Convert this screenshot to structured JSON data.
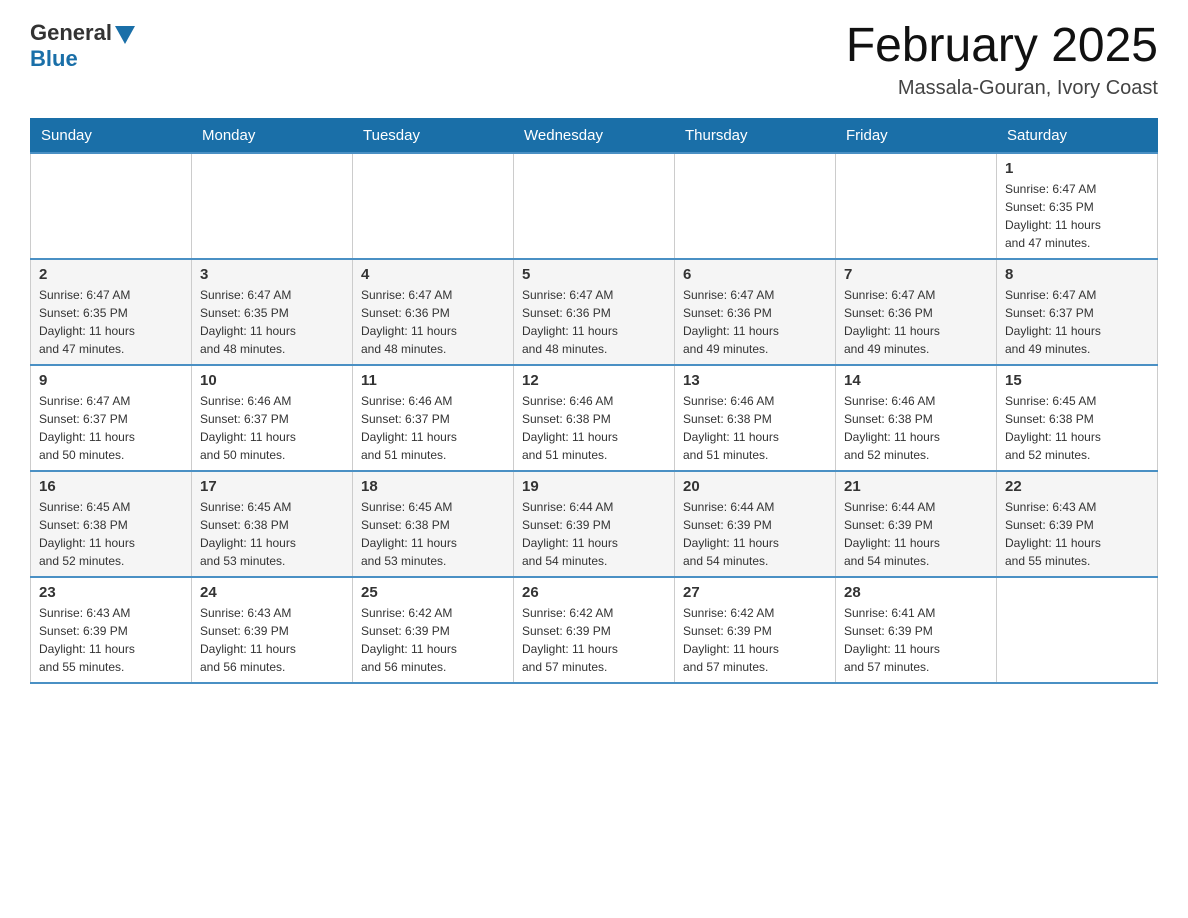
{
  "logo": {
    "general": "General",
    "blue": "Blue"
  },
  "title": "February 2025",
  "location": "Massala-Gouran, Ivory Coast",
  "days_of_week": [
    "Sunday",
    "Monday",
    "Tuesday",
    "Wednesday",
    "Thursday",
    "Friday",
    "Saturday"
  ],
  "weeks": [
    [
      {
        "day": "",
        "info": ""
      },
      {
        "day": "",
        "info": ""
      },
      {
        "day": "",
        "info": ""
      },
      {
        "day": "",
        "info": ""
      },
      {
        "day": "",
        "info": ""
      },
      {
        "day": "",
        "info": ""
      },
      {
        "day": "1",
        "info": "Sunrise: 6:47 AM\nSunset: 6:35 PM\nDaylight: 11 hours\nand 47 minutes."
      }
    ],
    [
      {
        "day": "2",
        "info": "Sunrise: 6:47 AM\nSunset: 6:35 PM\nDaylight: 11 hours\nand 47 minutes."
      },
      {
        "day": "3",
        "info": "Sunrise: 6:47 AM\nSunset: 6:35 PM\nDaylight: 11 hours\nand 48 minutes."
      },
      {
        "day": "4",
        "info": "Sunrise: 6:47 AM\nSunset: 6:36 PM\nDaylight: 11 hours\nand 48 minutes."
      },
      {
        "day": "5",
        "info": "Sunrise: 6:47 AM\nSunset: 6:36 PM\nDaylight: 11 hours\nand 48 minutes."
      },
      {
        "day": "6",
        "info": "Sunrise: 6:47 AM\nSunset: 6:36 PM\nDaylight: 11 hours\nand 49 minutes."
      },
      {
        "day": "7",
        "info": "Sunrise: 6:47 AM\nSunset: 6:36 PM\nDaylight: 11 hours\nand 49 minutes."
      },
      {
        "day": "8",
        "info": "Sunrise: 6:47 AM\nSunset: 6:37 PM\nDaylight: 11 hours\nand 49 minutes."
      }
    ],
    [
      {
        "day": "9",
        "info": "Sunrise: 6:47 AM\nSunset: 6:37 PM\nDaylight: 11 hours\nand 50 minutes."
      },
      {
        "day": "10",
        "info": "Sunrise: 6:46 AM\nSunset: 6:37 PM\nDaylight: 11 hours\nand 50 minutes."
      },
      {
        "day": "11",
        "info": "Sunrise: 6:46 AM\nSunset: 6:37 PM\nDaylight: 11 hours\nand 51 minutes."
      },
      {
        "day": "12",
        "info": "Sunrise: 6:46 AM\nSunset: 6:38 PM\nDaylight: 11 hours\nand 51 minutes."
      },
      {
        "day": "13",
        "info": "Sunrise: 6:46 AM\nSunset: 6:38 PM\nDaylight: 11 hours\nand 51 minutes."
      },
      {
        "day": "14",
        "info": "Sunrise: 6:46 AM\nSunset: 6:38 PM\nDaylight: 11 hours\nand 52 minutes."
      },
      {
        "day": "15",
        "info": "Sunrise: 6:45 AM\nSunset: 6:38 PM\nDaylight: 11 hours\nand 52 minutes."
      }
    ],
    [
      {
        "day": "16",
        "info": "Sunrise: 6:45 AM\nSunset: 6:38 PM\nDaylight: 11 hours\nand 52 minutes."
      },
      {
        "day": "17",
        "info": "Sunrise: 6:45 AM\nSunset: 6:38 PM\nDaylight: 11 hours\nand 53 minutes."
      },
      {
        "day": "18",
        "info": "Sunrise: 6:45 AM\nSunset: 6:38 PM\nDaylight: 11 hours\nand 53 minutes."
      },
      {
        "day": "19",
        "info": "Sunrise: 6:44 AM\nSunset: 6:39 PM\nDaylight: 11 hours\nand 54 minutes."
      },
      {
        "day": "20",
        "info": "Sunrise: 6:44 AM\nSunset: 6:39 PM\nDaylight: 11 hours\nand 54 minutes."
      },
      {
        "day": "21",
        "info": "Sunrise: 6:44 AM\nSunset: 6:39 PM\nDaylight: 11 hours\nand 54 minutes."
      },
      {
        "day": "22",
        "info": "Sunrise: 6:43 AM\nSunset: 6:39 PM\nDaylight: 11 hours\nand 55 minutes."
      }
    ],
    [
      {
        "day": "23",
        "info": "Sunrise: 6:43 AM\nSunset: 6:39 PM\nDaylight: 11 hours\nand 55 minutes."
      },
      {
        "day": "24",
        "info": "Sunrise: 6:43 AM\nSunset: 6:39 PM\nDaylight: 11 hours\nand 56 minutes."
      },
      {
        "day": "25",
        "info": "Sunrise: 6:42 AM\nSunset: 6:39 PM\nDaylight: 11 hours\nand 56 minutes."
      },
      {
        "day": "26",
        "info": "Sunrise: 6:42 AM\nSunset: 6:39 PM\nDaylight: 11 hours\nand 57 minutes."
      },
      {
        "day": "27",
        "info": "Sunrise: 6:42 AM\nSunset: 6:39 PM\nDaylight: 11 hours\nand 57 minutes."
      },
      {
        "day": "28",
        "info": "Sunrise: 6:41 AM\nSunset: 6:39 PM\nDaylight: 11 hours\nand 57 minutes."
      },
      {
        "day": "",
        "info": ""
      }
    ]
  ]
}
